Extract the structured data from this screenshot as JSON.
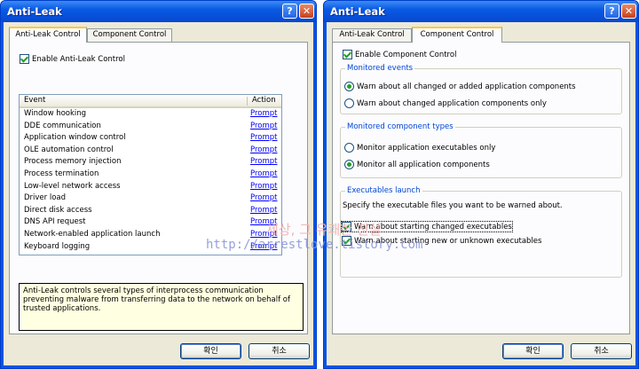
{
  "left_window": {
    "title": "Anti-Leak",
    "help_btn": "?",
    "close_btn": "✕",
    "tabs": [
      "Anti-Leak Control",
      "Component Control"
    ],
    "enable_label": "Enable Anti-Leak Control",
    "enable_checked": true,
    "list_headers": {
      "event": "Event",
      "action": "Action"
    },
    "rows": [
      {
        "event": "Window hooking",
        "action": "Prompt"
      },
      {
        "event": "DDE communication",
        "action": "Prompt"
      },
      {
        "event": "Application window control",
        "action": "Prompt"
      },
      {
        "event": "OLE automation control",
        "action": "Prompt"
      },
      {
        "event": "Process memory injection",
        "action": "Prompt"
      },
      {
        "event": "Process termination",
        "action": "Prompt"
      },
      {
        "event": "Low-level network access",
        "action": "Prompt"
      },
      {
        "event": "Driver load",
        "action": "Prompt"
      },
      {
        "event": "Direct disk access",
        "action": "Prompt"
      },
      {
        "event": "DNS API request",
        "action": "Prompt"
      },
      {
        "event": "Network-enabled application launch",
        "action": "Prompt"
      },
      {
        "event": "Keyboard logging",
        "action": "Prompt"
      }
    ],
    "description": "Anti-Leak controls several types of interprocess communication preventing malware from transferring data to the network on behalf of trusted applications.",
    "ok": "확인",
    "cancel": "취소"
  },
  "right_window": {
    "title": "Anti-Leak",
    "help_btn": "?",
    "close_btn": "✕",
    "tabs": [
      "Anti-Leak Control",
      "Component Control"
    ],
    "enable_label": "Enable Component Control",
    "enable_checked": true,
    "monitored_events": {
      "label": "Monitored events",
      "options": [
        "Warn about all changed or added application components",
        "Warn about changed application components only"
      ],
      "selected": 0
    },
    "monitored_types": {
      "label": "Monitored component types",
      "options": [
        "Monitor application executables only",
        "Monitor all application components"
      ],
      "selected": 1
    },
    "executables_launch": {
      "label": "Executables launch",
      "instruction": "Specify the executable files you want to be warned about.",
      "options": [
        {
          "label": "Warn about starting changed executables",
          "checked": true
        },
        {
          "label": "Warn about starting new or unknown executables",
          "checked": true
        }
      ]
    },
    "ok": "확인",
    "cancel": "취소"
  },
  "watermark": {
    "korean": "세상, 그 유쾌한 진실",
    "url": "http://arrestlove.tistory.com"
  }
}
